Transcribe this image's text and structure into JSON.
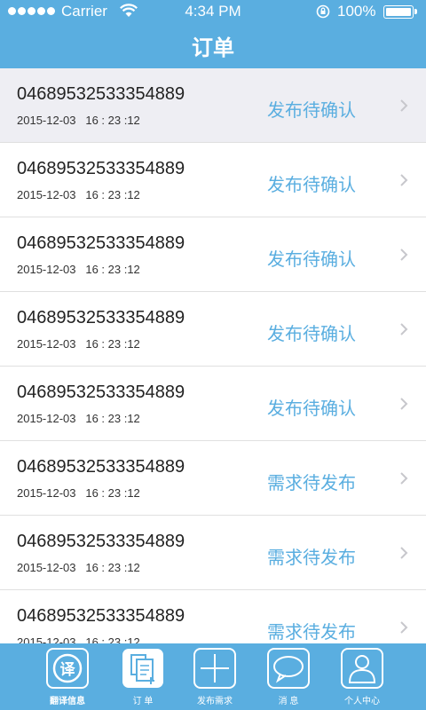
{
  "status_bar": {
    "carrier": "Carrier",
    "time": "4:34 PM",
    "battery": "100%"
  },
  "header": {
    "title": "订单"
  },
  "orders": [
    {
      "number": "04689532533354889",
      "date": "2015-12-03",
      "time": "16 : 23 :12",
      "status": "发布待确认",
      "selected": true
    },
    {
      "number": "04689532533354889",
      "date": "2015-12-03",
      "time": "16 : 23 :12",
      "status": "发布待确认"
    },
    {
      "number": "04689532533354889",
      "date": "2015-12-03",
      "time": "16 : 23 :12",
      "status": "发布待确认"
    },
    {
      "number": "04689532533354889",
      "date": "2015-12-03",
      "time": "16 : 23 :12",
      "status": "发布待确认"
    },
    {
      "number": "04689532533354889",
      "date": "2015-12-03",
      "time": "16 : 23 :12",
      "status": "发布待确认"
    },
    {
      "number": "04689532533354889",
      "date": "2015-12-03",
      "time": "16 : 23 :12",
      "status": "需求待发布"
    },
    {
      "number": "04689532533354889",
      "date": "2015-12-03",
      "time": "16 : 23 :12",
      "status": "需求待发布"
    },
    {
      "number": "04689532533354889",
      "date": "2015-12-03",
      "time": "16 : 23 :12",
      "status": "需求待发布"
    }
  ],
  "tabbar": {
    "items": [
      {
        "label": "翻译信息",
        "icon": "translate-icon",
        "glyph": "译"
      },
      {
        "label": "订  单",
        "icon": "orders-icon",
        "active": true
      },
      {
        "label": "发布需求",
        "icon": "plus-icon"
      },
      {
        "label": "消  息",
        "icon": "message-icon"
      },
      {
        "label": "个人中心",
        "icon": "person-icon"
      }
    ]
  },
  "colors": {
    "primary": "#5aaee0",
    "selected_row": "#eeeef3",
    "text": "#222222"
  }
}
